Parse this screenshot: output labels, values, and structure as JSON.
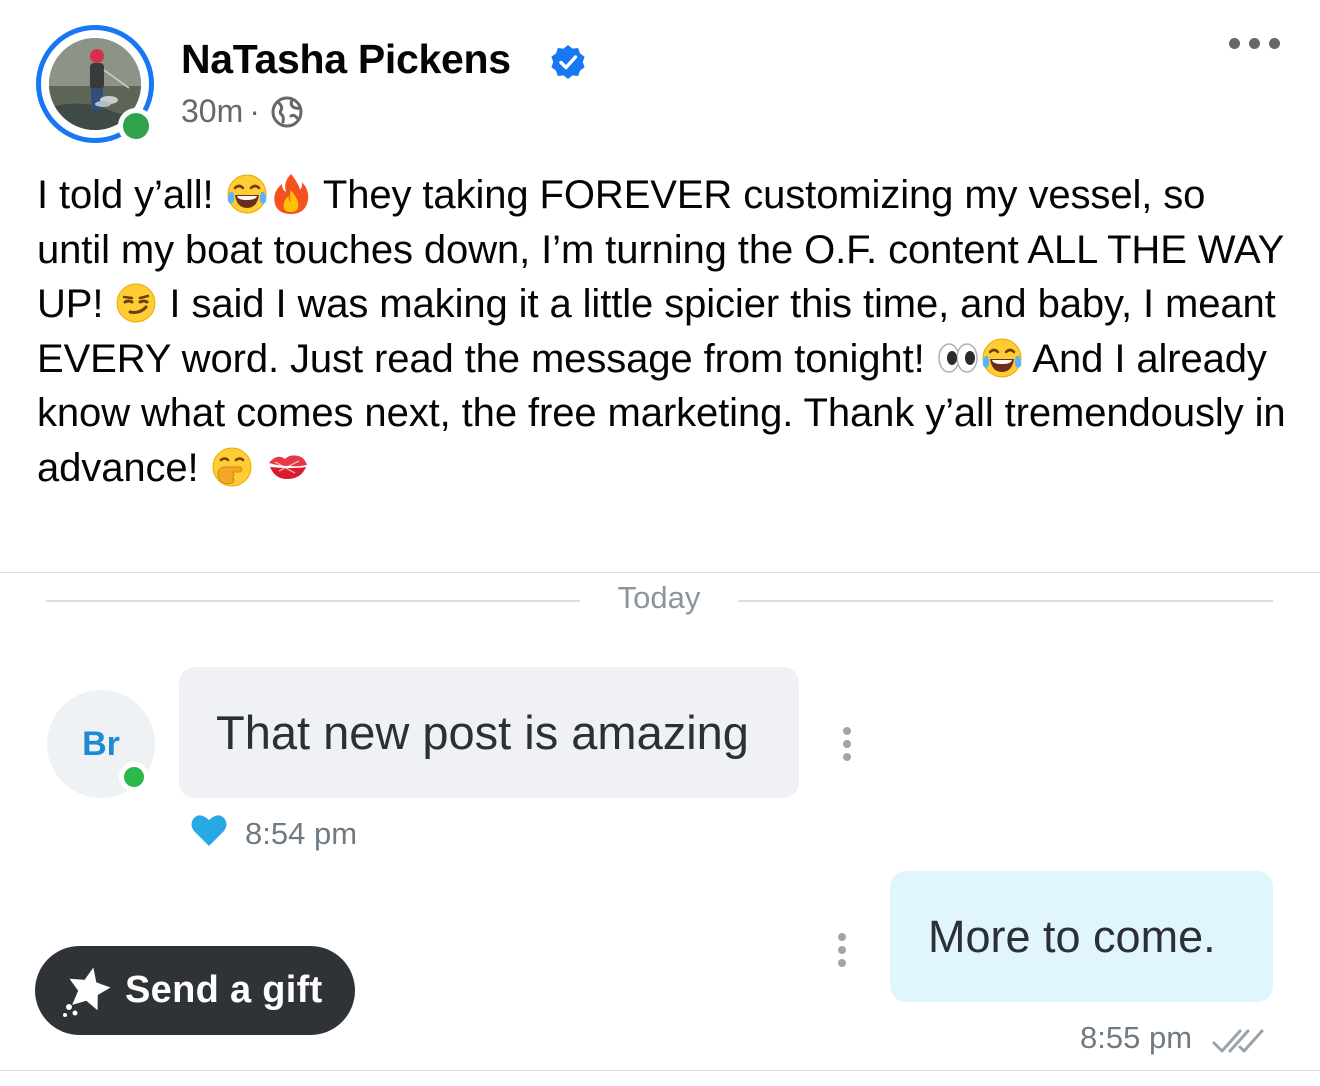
{
  "post": {
    "author_name": "NaTasha Pickens",
    "verified": true,
    "timestamp": "30m",
    "meta_separator": "·",
    "audience_icon": "globe-icon",
    "more_icon": "more-horizontal-icon",
    "body_segments": [
      "I told y’all! ",
      " They taking FOREVER customizing my vessel, so until my boat touches down, I’m turning the O.F. content ALL THE WAY UP! ",
      " I said I was making it a little spicier this time, and baby, I meant EVERY word. Just read the message from tonight! ",
      " And I already know what comes next, the free marketing. Thank y’all tremendously in advance! "
    ],
    "emojis": [
      "face-with-tears-of-joy",
      "fire",
      "smirking-face",
      "eyes",
      "face-with-tears-of-joy",
      "face-with-hand-over-mouth",
      "kiss-mark"
    ]
  },
  "chat": {
    "day_label": "Today",
    "contact_initials": "Br",
    "incoming_message": "That new post is amazing",
    "incoming_time": "8:54 pm",
    "incoming_reaction_icon": "blue-heart-icon",
    "outgoing_message": "More to come.",
    "outgoing_time": "8:55 pm",
    "outgoing_status_icon": "double-check-icon",
    "gift_button_label": "Send a gift",
    "gift_icon": "star-sparkle-icon"
  },
  "colors": {
    "facebook_blue": "#1877f2",
    "online_green": "#31a24c",
    "incoming_bubble": "#eff1f4",
    "outgoing_bubble": "#e1f5fe",
    "gift_button_bg": "#2f3236",
    "initials_blue": "#1d8bd1"
  }
}
